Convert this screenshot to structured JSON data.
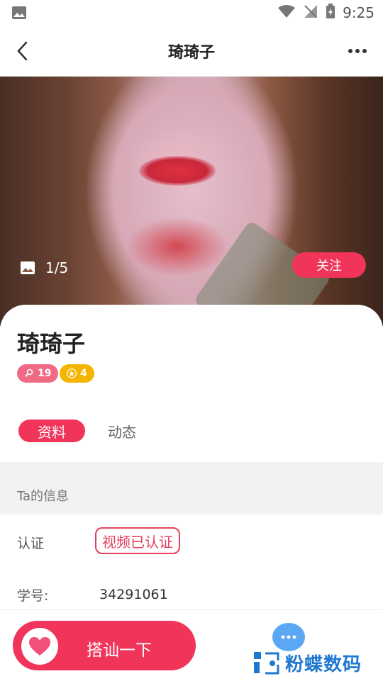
{
  "status_bar": {
    "time": "9:25"
  },
  "header": {
    "title": "琦琦子"
  },
  "photo": {
    "counter": "1/5",
    "follow_label": "关注"
  },
  "profile": {
    "name": "琦琦子",
    "age_badge": "19",
    "level_badge": "4"
  },
  "tabs": [
    {
      "label": "资料",
      "active": true
    },
    {
      "label": "动态",
      "active": false
    }
  ],
  "section": {
    "title": "Ta的信息"
  },
  "info_rows": {
    "verify_label": "认证",
    "verify_value": "视频已认证",
    "id_label": "学号:",
    "id_value": "34291061"
  },
  "bottom_bar": {
    "chat_up_label": "搭讪一下"
  },
  "watermark": {
    "text": "粉蝶数码"
  },
  "colors": {
    "accent": "#f0345a",
    "gender_badge": "#f06a85",
    "level_badge": "#f5b400",
    "message_button": "#5aa8f3"
  },
  "icons": [
    "image-icon",
    "wifi-icon",
    "no-signal-icon",
    "battery-icon",
    "back-arrow-icon",
    "more-dots-icon",
    "photo-gallery-icon",
    "female-icon",
    "star-icon",
    "heart-icon",
    "chat-bubble-icon"
  ]
}
